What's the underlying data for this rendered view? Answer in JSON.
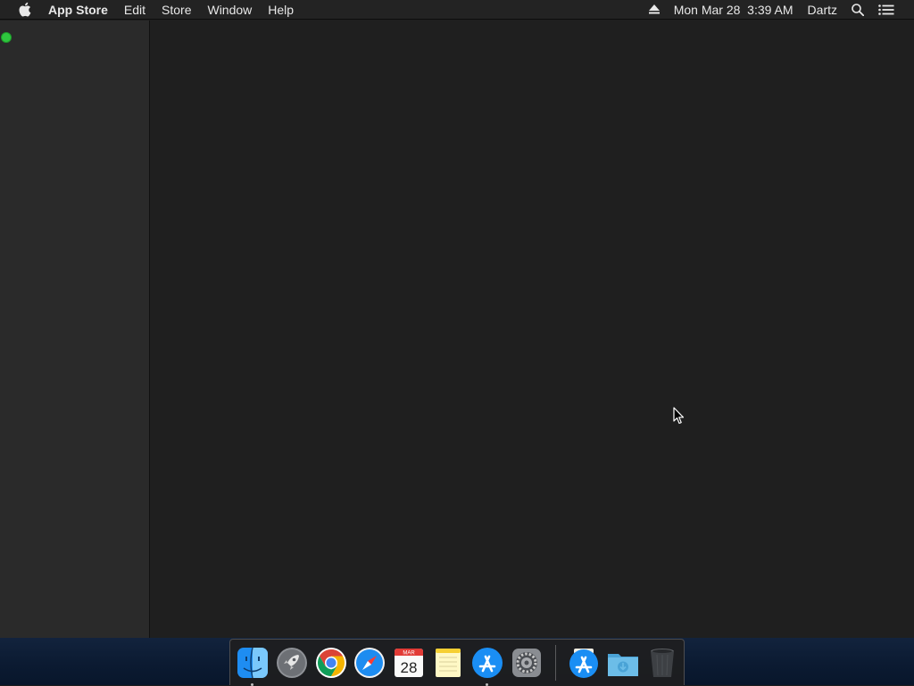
{
  "menubar": {
    "app_name": "App Store",
    "menus": [
      "Edit",
      "Store",
      "Window",
      "Help"
    ],
    "datetime": "Mon Mar 28  3:39 AM",
    "user": "Dartz"
  },
  "window": {
    "traffic_light_color": "#2ec63e"
  },
  "dock": {
    "calendar_month": "MAR",
    "calendar_day": "28"
  },
  "colors": {
    "menubar_bg": "#232323",
    "sidebar_bg": "#2a2a2a",
    "content_bg": "#1f1f1f"
  }
}
